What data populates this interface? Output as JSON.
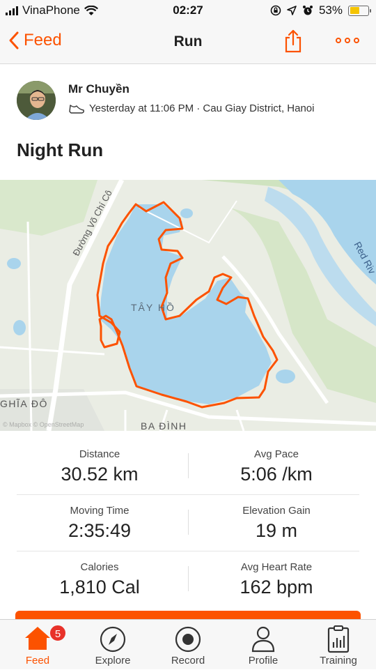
{
  "status_bar": {
    "carrier": "VinaPhone",
    "time": "02:27",
    "battery_percent": "53%",
    "battery_level": 0.53
  },
  "nav": {
    "back_label": "Feed",
    "title": "Run"
  },
  "activity": {
    "athlete_name": "Mr Chuyền",
    "meta": "Yesterday at 11:06 PM · Cau Giay District, Hanoi",
    "title": "Night Run"
  },
  "map": {
    "lake_label": "TÂY HỒ",
    "street_label": "Đường Võ Chí Cô",
    "river_label": "Red Riv",
    "district_label_left": "GHĨA ĐÔ",
    "district_label_bottom": "BA ĐÌNH",
    "attribution": "© Mapbox © OpenStreetMap",
    "route_color": "#fc5200",
    "water_color": "#a9d4ec"
  },
  "stats": [
    {
      "label": "Distance",
      "value": "30.52 km"
    },
    {
      "label": "Avg Pace",
      "value": "5:06 /km"
    },
    {
      "label": "Moving Time",
      "value": "2:35:49"
    },
    {
      "label": "Elevation Gain",
      "value": "19 m"
    },
    {
      "label": "Calories",
      "value": "1,810 Cal"
    },
    {
      "label": "Avg Heart Rate",
      "value": "162 bpm"
    }
  ],
  "tabs": [
    {
      "label": "Feed",
      "icon": "home-icon",
      "badge": "5",
      "active": true
    },
    {
      "label": "Explore",
      "icon": "compass-icon"
    },
    {
      "label": "Record",
      "icon": "record-icon"
    },
    {
      "label": "Profile",
      "icon": "person-icon"
    },
    {
      "label": "Training",
      "icon": "clipboard-chart-icon"
    }
  ],
  "colors": {
    "brand": "#fc5200",
    "badge": "#e8322a"
  }
}
